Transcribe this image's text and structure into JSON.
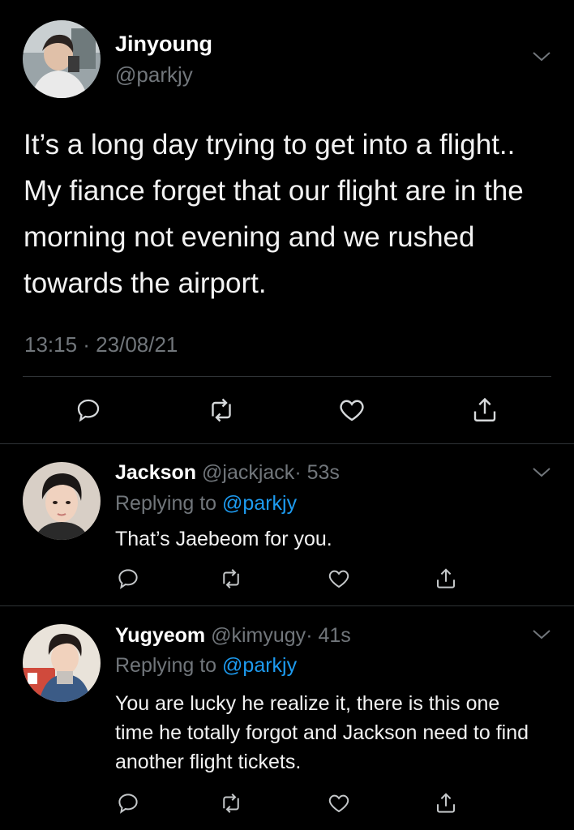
{
  "main_tweet": {
    "display_name": "Jinyoung",
    "handle": "@parkjy",
    "text": "It’s a long day trying to get into a flight.. My fiance forget that our flight are in the morning not evening and we rushed towards the airport.",
    "timestamp": "13:15 · 23/08/21"
  },
  "replies": [
    {
      "display_name": "Jackson",
      "handle": "@jackjack",
      "time": "· 53s",
      "replying_prefix": "Replying to",
      "replying_to": "@parkjy",
      "text": "That’s Jaebeom for you."
    },
    {
      "display_name": "Yugyeom",
      "handle": "@kimyugy",
      "time": "· 41s",
      "replying_prefix": "Replying to",
      "replying_to": "@parkjy",
      "text": "You are lucky he realize it, there is this one time he totally forgot and Jackson need to find another flight tickets."
    }
  ],
  "icons": {
    "reply": "reply-icon",
    "retweet": "retweet-icon",
    "like": "heart-icon",
    "share": "share-icon",
    "more": "chevron-down-icon"
  },
  "colors": {
    "background": "#000000",
    "text": "#e7e9ea",
    "muted": "#71767b",
    "link": "#1d9bf0"
  }
}
